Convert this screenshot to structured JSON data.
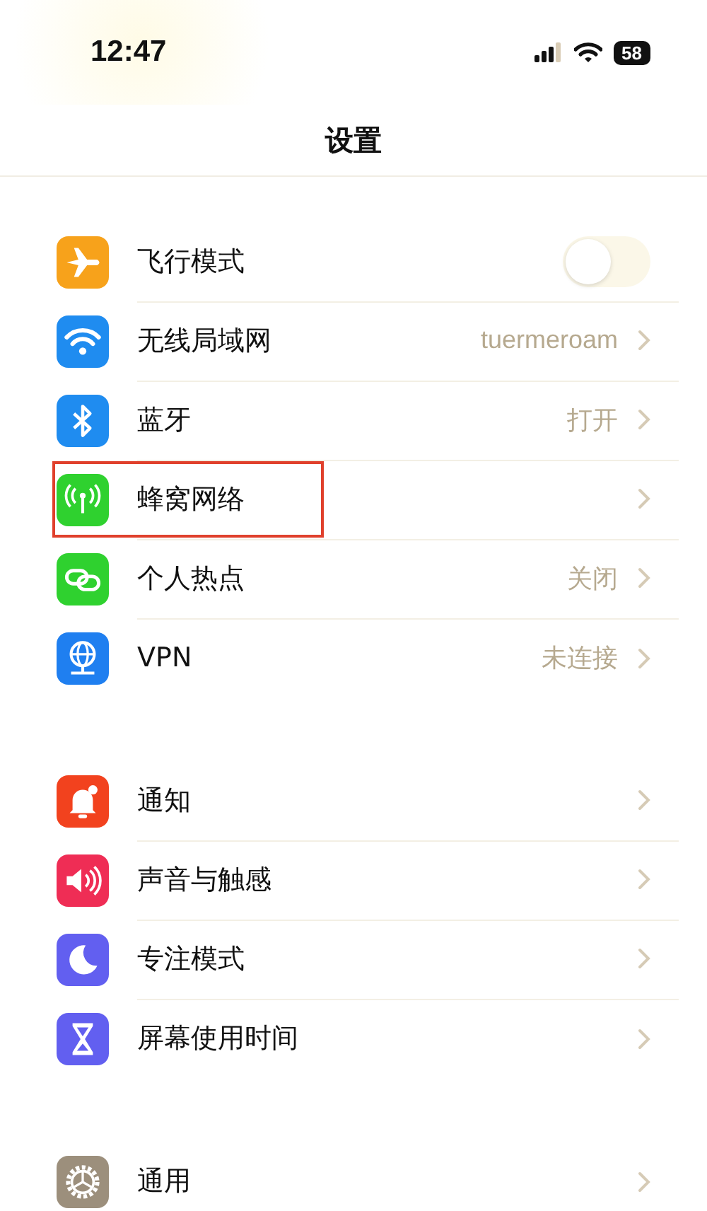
{
  "status_bar": {
    "time": "12:47",
    "battery": "58"
  },
  "title": "设置",
  "groups": [
    {
      "items": [
        {
          "label": "飞行模式",
          "kind": "toggle",
          "on": false,
          "highlighted": false
        },
        {
          "label": "无线局域网",
          "kind": "link",
          "value": "tuermeroam",
          "highlighted": false
        },
        {
          "label": "蓝牙",
          "kind": "link",
          "value": "打开",
          "highlighted": false
        },
        {
          "label": "蜂窝网络",
          "kind": "link",
          "highlighted": true
        },
        {
          "label": "个人热点",
          "kind": "link",
          "value": "关闭",
          "highlighted": false
        },
        {
          "label": "VPN",
          "kind": "link",
          "value": "未连接",
          "highlighted": false
        }
      ]
    },
    {
      "items": [
        {
          "label": "通知",
          "kind": "link",
          "highlighted": false
        },
        {
          "label": "声音与触感",
          "kind": "link",
          "highlighted": false
        },
        {
          "label": "专注模式",
          "kind": "link",
          "highlighted": false
        },
        {
          "label": "屏幕使用时间",
          "kind": "link",
          "highlighted": false
        }
      ]
    },
    {
      "items": [
        {
          "label": "通用",
          "kind": "link",
          "highlighted": false
        }
      ]
    }
  ]
}
